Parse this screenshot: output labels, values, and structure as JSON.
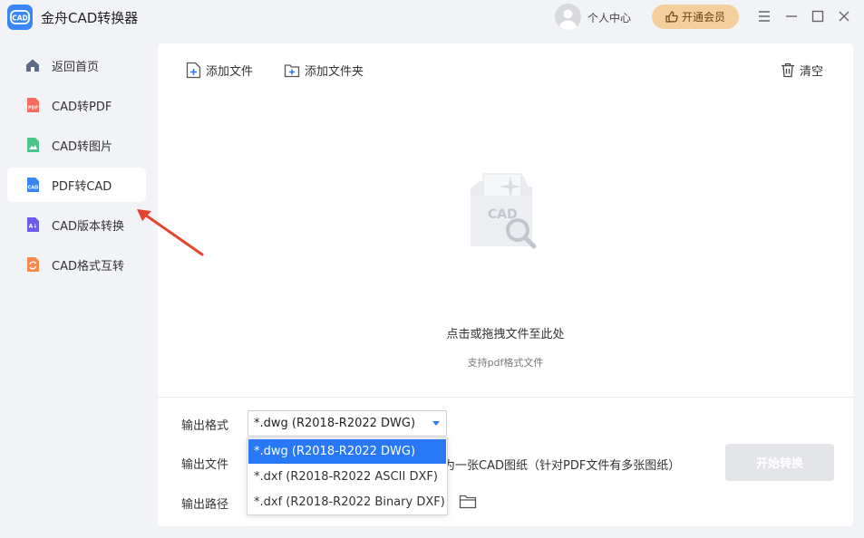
{
  "app": {
    "title": "金舟CAD转换器",
    "logo_text": "CAD"
  },
  "header": {
    "user_center": "个人中心",
    "vip_label": "开通会员"
  },
  "sidebar": {
    "items": [
      {
        "label": "返回首页",
        "icon": "home-icon",
        "active": false
      },
      {
        "label": "CAD转PDF",
        "icon": "pdf-file-icon",
        "active": false
      },
      {
        "label": "CAD转图片",
        "icon": "image-file-icon",
        "active": false
      },
      {
        "label": "PDF转CAD",
        "icon": "cad-file-icon",
        "active": true
      },
      {
        "label": "CAD版本转换",
        "icon": "version-convert-icon",
        "active": false
      },
      {
        "label": "CAD格式互转",
        "icon": "format-convert-icon",
        "active": false
      }
    ]
  },
  "toolbar": {
    "add_file": "添加文件",
    "add_folder": "添加文件夹",
    "clear": "清空"
  },
  "drop_zone": {
    "title": "点击或拖拽文件至此处",
    "subtitle": "支持pdf格式文件",
    "illustration_text": "CAD"
  },
  "options": {
    "format_label": "输出格式",
    "format_value": "*.dwg (R2018-R2022 DWG)",
    "file_label": "输出文件",
    "file_hint": "为一张CAD图纸（针对PDF文件有多张图纸）",
    "path_label": "输出路径",
    "format_options": [
      "*.dwg (R2018-R2022 DWG)",
      "*.dxf (R2018-R2022 ASCII DXF)",
      "*.dxf (R2018-R2022 Binary DXF)"
    ],
    "selected_index": 0
  },
  "start_button": "开始转换",
  "colors": {
    "accent": "#2979f6",
    "vip_bg": "#f2cf9c",
    "start_disabled": "#e2e4e8",
    "annotation": "#e2462f"
  }
}
